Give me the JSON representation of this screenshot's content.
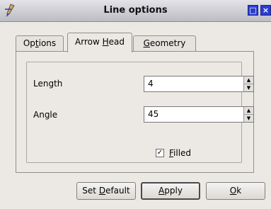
{
  "window": {
    "title": "Line options",
    "maximize_glyph": "□",
    "close_glyph": "×"
  },
  "tabs": [
    {
      "pre": "Op",
      "key": "t",
      "post": "ions"
    },
    {
      "pre": "Arrow ",
      "key": "H",
      "post": "ead"
    },
    {
      "pre": "",
      "key": "G",
      "post": "eometry"
    }
  ],
  "fields": {
    "length": {
      "label": "Length",
      "value": "4"
    },
    "angle": {
      "label": "Angle",
      "value": "45"
    }
  },
  "filled": {
    "pre": "",
    "key": "F",
    "post": "illed",
    "checked": true,
    "check_glyph": "✓"
  },
  "buttons": {
    "set_default": {
      "pre": "Set ",
      "key": "D",
      "post": "efault"
    },
    "apply": {
      "pre": "",
      "key": "A",
      "post": "pply"
    },
    "ok": {
      "pre": "",
      "key": "O",
      "post": "k"
    }
  },
  "spin_glyphs": {
    "up": "▲",
    "down": "▼"
  },
  "icons": {
    "app": "pen-tool-icon"
  }
}
